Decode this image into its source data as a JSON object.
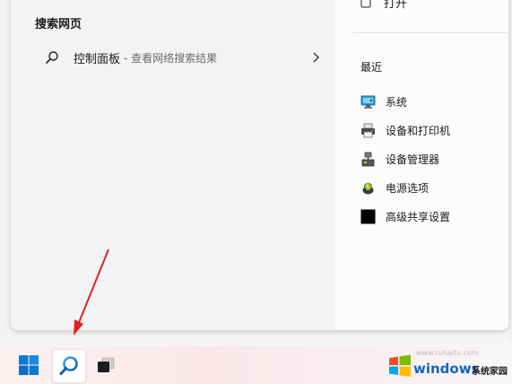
{
  "search_panel": {
    "section_title": "搜索网页",
    "web_result": {
      "label": "控制面板",
      "hint": "- 查看网络搜索结果",
      "icon": "search-icon"
    }
  },
  "right_pane": {
    "open_label": "打开",
    "recent_title": "最近",
    "recent_items": [
      {
        "label": "系统",
        "icon": "system-monitor-icon"
      },
      {
        "label": "设备和打印机",
        "icon": "printer-icon"
      },
      {
        "label": "设备管理器",
        "icon": "device-manager-icon"
      },
      {
        "label": "电源选项",
        "icon": "power-options-icon"
      },
      {
        "label": "高级共享设置",
        "icon": "black-square-icon"
      }
    ]
  },
  "taskbar": {
    "items": [
      "windows-start-icon",
      "search-icon",
      "task-view-icon"
    ],
    "accent": "#0078d4"
  },
  "watermark": {
    "brand": "windows",
    "suffix": "系统家园",
    "url": "www.ruhaitu.com"
  },
  "annotation": {
    "color": "#e02020"
  }
}
